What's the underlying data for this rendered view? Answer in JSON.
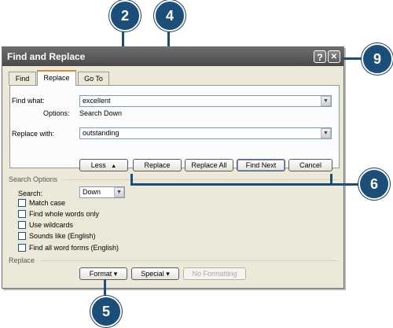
{
  "dialog": {
    "title": "Find and Replace",
    "help_glyph": "?",
    "close_glyph": "✕"
  },
  "tabs": [
    {
      "label": "Find",
      "active": false
    },
    {
      "label": "Replace",
      "active": true
    },
    {
      "label": "Go To",
      "active": false
    }
  ],
  "find": {
    "label": "Find what:",
    "value": "excellent",
    "options_label": "Options:",
    "options_value": "Search Down"
  },
  "replace": {
    "label": "Replace with:",
    "value": "outstanding"
  },
  "buttons": {
    "less": "Less",
    "less_arrow": "▲",
    "replace": "Replace",
    "replace_all": "Replace All",
    "find_next": "Find Next",
    "cancel": "Cancel"
  },
  "search_options": {
    "heading": "Search Options",
    "search_label": "Search:",
    "search_value": "Down",
    "checkboxes": [
      {
        "label": "Match case",
        "checked": false
      },
      {
        "label": "Find whole words only",
        "checked": false
      },
      {
        "label": "Use wildcards",
        "checked": false
      },
      {
        "label": "Sounds like (English)",
        "checked": false
      },
      {
        "label": "Find all word forms (English)",
        "checked": false
      }
    ]
  },
  "replace_section": {
    "heading": "Replace",
    "format": "Format",
    "special": "Special",
    "no_formatting": "No Formatting",
    "menu_arrow": "▾"
  },
  "callouts": {
    "c2": "2",
    "c4": "4",
    "c9": "9",
    "c6": "6",
    "c5": "5"
  },
  "colors": {
    "callout": "#1c4e7a",
    "titlebar": "#5a5a5a",
    "dialog_bg": "#ece9d8"
  }
}
